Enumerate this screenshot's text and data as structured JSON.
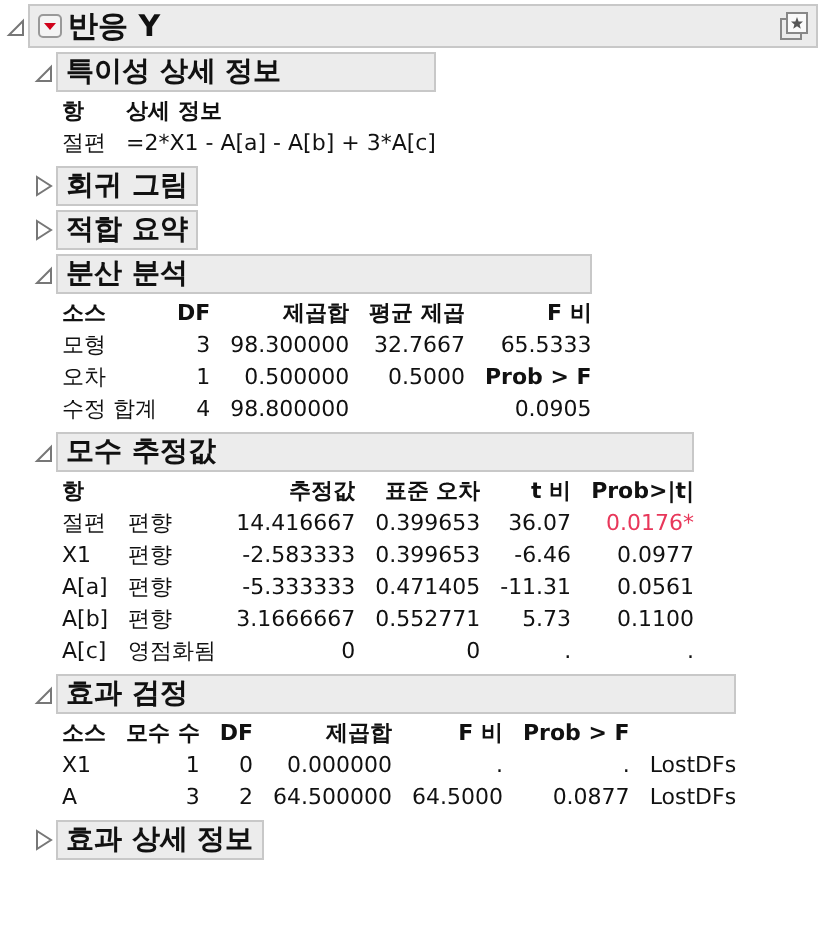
{
  "report": {
    "title": "반응 Y",
    "expanded": true,
    "sections": [
      {
        "title": "특이성 상세 정보",
        "expanded": true,
        "table": {
          "columns": [
            {
              "label": "항",
              "kind": "text"
            },
            {
              "label": "상세 정보",
              "kind": "text"
            }
          ],
          "rows": [
            [
              {
                "text": "절편"
              },
              {
                "text": "=2*X1 - A[a] - A[b] + 3*A[c]"
              }
            ]
          ]
        }
      },
      {
        "title": "회귀 그림",
        "expanded": false
      },
      {
        "title": "적합 요약",
        "expanded": false
      },
      {
        "title": "분산 분석",
        "expanded": true,
        "table": {
          "columns": [
            {
              "label": "소스",
              "kind": "text"
            },
            {
              "label": "DF",
              "kind": "number"
            },
            {
              "label": "제곱합",
              "kind": "number"
            },
            {
              "label": "평균 제곱",
              "kind": "number"
            },
            {
              "label": "F 비",
              "kind": "number"
            }
          ],
          "rows": [
            [
              {
                "text": "모형"
              },
              {
                "text": "3"
              },
              {
                "text": "98.300000"
              },
              {
                "text": "32.7667"
              },
              {
                "text": "65.5333"
              }
            ],
            [
              {
                "text": "오차"
              },
              {
                "text": "1"
              },
              {
                "text": "0.500000"
              },
              {
                "text": "0.5000"
              },
              {
                "text": "Prob > F",
                "kind": "label"
              }
            ],
            [
              {
                "text": "수정 합계"
              },
              {
                "text": "4"
              },
              {
                "text": "98.800000"
              },
              {
                "text": ""
              },
              {
                "text": "0.0905"
              }
            ]
          ]
        }
      },
      {
        "title": "모수 추정값",
        "expanded": true,
        "table": {
          "columns": [
            {
              "label": "항",
              "kind": "text"
            },
            {
              "kind": "text"
            },
            {
              "label": "추정값",
              "kind": "number"
            },
            {
              "label": "표준 오차",
              "kind": "number"
            },
            {
              "label": "t 비",
              "kind": "number"
            },
            {
              "label": "Prob>|t|",
              "kind": "prob"
            }
          ],
          "rows": [
            [
              {
                "text": "절편"
              },
              {
                "text": "편향"
              },
              {
                "text": "14.416667"
              },
              {
                "text": "0.399653"
              },
              {
                "text": "36.07"
              },
              {
                "text": "0.0176*",
                "significant": true
              }
            ],
            [
              {
                "text": "X1"
              },
              {
                "text": "편향"
              },
              {
                "text": "-2.583333"
              },
              {
                "text": "0.399653"
              },
              {
                "text": "-6.46"
              },
              {
                "text": "0.0977",
                "significant": false
              }
            ],
            [
              {
                "text": "A[a]"
              },
              {
                "text": "편향"
              },
              {
                "text": "-5.333333"
              },
              {
                "text": "0.471405"
              },
              {
                "text": "-11.31"
              },
              {
                "text": "0.0561",
                "significant": false
              }
            ],
            [
              {
                "text": "A[b]"
              },
              {
                "text": "편향"
              },
              {
                "text": "3.1666667"
              },
              {
                "text": "0.552771"
              },
              {
                "text": "5.73"
              },
              {
                "text": "0.1100",
                "significant": false
              }
            ],
            [
              {
                "text": "A[c]"
              },
              {
                "text": "영점화됨"
              },
              {
                "text": "0"
              },
              {
                "text": "0"
              },
              {
                "text": "."
              },
              {
                "text": ".",
                "significant": false
              }
            ]
          ]
        }
      },
      {
        "title": "효과 검정",
        "expanded": true,
        "table": {
          "columns": [
            {
              "label": "소스",
              "kind": "text"
            },
            {
              "label": "모수 수",
              "kind": "number"
            },
            {
              "label": "DF",
              "kind": "number"
            },
            {
              "label": "제곱합",
              "kind": "number"
            },
            {
              "label": "F 비",
              "kind": "number"
            },
            {
              "label": "Prob > F",
              "kind": "number"
            },
            {
              "kind": "text"
            }
          ],
          "rows": [
            [
              {
                "text": "X1"
              },
              {
                "text": "1"
              },
              {
                "text": "0"
              },
              {
                "text": "0.000000"
              },
              {
                "text": "."
              },
              {
                "text": "."
              },
              {
                "text": "LostDFs"
              }
            ],
            [
              {
                "text": "A"
              },
              {
                "text": "3"
              },
              {
                "text": "2"
              },
              {
                "text": "64.500000"
              },
              {
                "text": "64.5000"
              },
              {
                "text": "0.0877"
              },
              {
                "text": "LostDFs"
              }
            ]
          ]
        }
      },
      {
        "title": "효과 상세 정보",
        "expanded": false
      }
    ]
  }
}
